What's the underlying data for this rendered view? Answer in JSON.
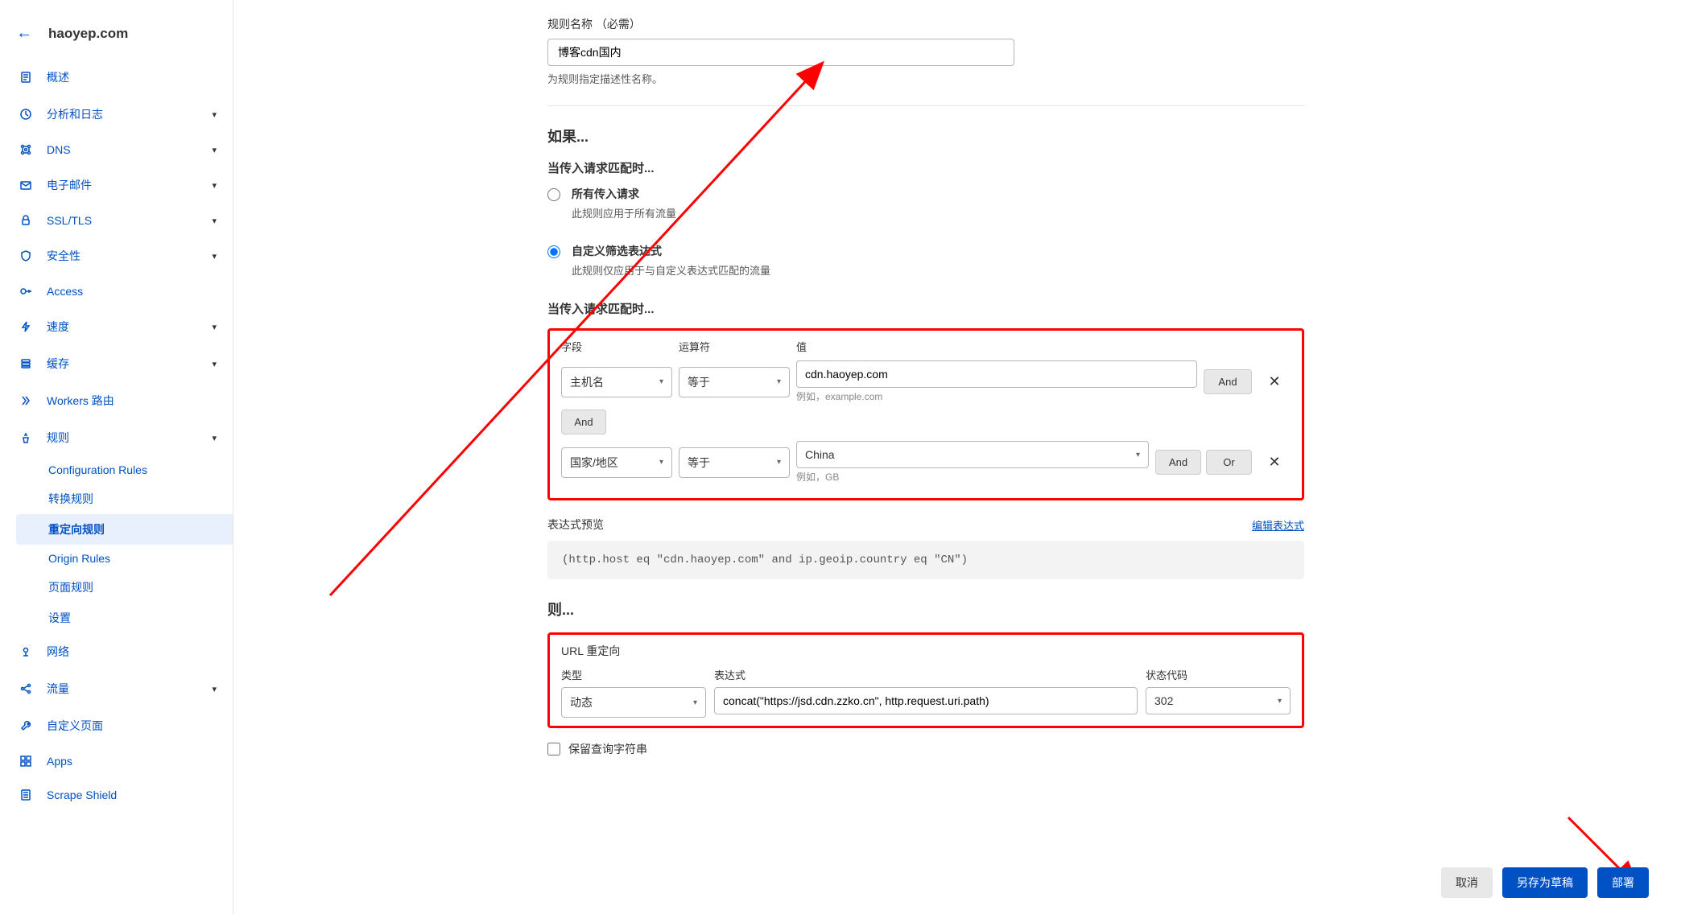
{
  "header": {
    "domain": "haoyep.com"
  },
  "sidebar": {
    "items": [
      {
        "label": "概述",
        "icon": "file"
      },
      {
        "label": "分析和日志",
        "icon": "clock",
        "expandable": true
      },
      {
        "label": "DNS",
        "icon": "dns",
        "expandable": true
      },
      {
        "label": "电子邮件",
        "icon": "mail",
        "expandable": true
      },
      {
        "label": "SSL/TLS",
        "icon": "lock",
        "expandable": true
      },
      {
        "label": "安全性",
        "icon": "shield",
        "expandable": true
      },
      {
        "label": "Access",
        "icon": "access"
      },
      {
        "label": "速度",
        "icon": "bolt",
        "expandable": true
      },
      {
        "label": "缓存",
        "icon": "stack",
        "expandable": true
      },
      {
        "label": "Workers 路由",
        "icon": "workers"
      },
      {
        "label": "规则",
        "icon": "rules",
        "expandable": true
      }
    ],
    "rules_sub": [
      {
        "label": "Configuration Rules"
      },
      {
        "label": "转换规则"
      },
      {
        "label": "重定向规则",
        "active": true
      },
      {
        "label": "Origin Rules"
      },
      {
        "label": "页面规则"
      },
      {
        "label": "设置"
      }
    ],
    "items_after": [
      {
        "label": "网络",
        "icon": "network"
      },
      {
        "label": "流量",
        "icon": "traffic",
        "expandable": true
      },
      {
        "label": "自定义页面",
        "icon": "wrench"
      },
      {
        "label": "Apps",
        "icon": "apps"
      },
      {
        "label": "Scrape Shield",
        "icon": "scrape"
      }
    ]
  },
  "form": {
    "rule_name_label": "规则名称 （必需）",
    "rule_name_value": "博客cdn国内",
    "rule_name_help": "为规则指定描述性名称。",
    "if_title": "如果...",
    "match_title": "当传入请求匹配时...",
    "radio_all_label": "所有传入请求",
    "radio_all_desc": "此规则应用于所有流量",
    "radio_custom_label": "自定义筛选表达式",
    "radio_custom_desc": "此规则仅应用于与自定义表达式匹配的流量",
    "filter_title": "当传入请求匹配时...",
    "col_field": "字段",
    "col_operator": "运算符",
    "col_value": "值",
    "row1": {
      "field": "主机名",
      "operator": "等于",
      "value": "cdn.haoyep.com",
      "example": "例如，example.com"
    },
    "and_btn": "And",
    "or_btn": "Or",
    "row2": {
      "field": "国家/地区",
      "operator": "等于",
      "value": "China",
      "example": "例如，GB"
    },
    "preview_label": "表达式预览",
    "edit_expr": "编辑表达式",
    "expression": "(http.host eq \"cdn.haoyep.com\" and ip.geoip.country eq \"CN\")",
    "then_title": "则...",
    "url_redirect_label": "URL 重定向",
    "type_label": "类型",
    "type_value": "动态",
    "expr_label": "表达式",
    "expr_value": "concat(\"https://jsd.cdn.zzko.cn\", http.request.uri.path)",
    "status_label": "状态代码",
    "status_value": "302",
    "keep_query": "保留查询字符串"
  },
  "footer": {
    "cancel": "取消",
    "save_draft": "另存为草稿",
    "deploy": "部署"
  }
}
